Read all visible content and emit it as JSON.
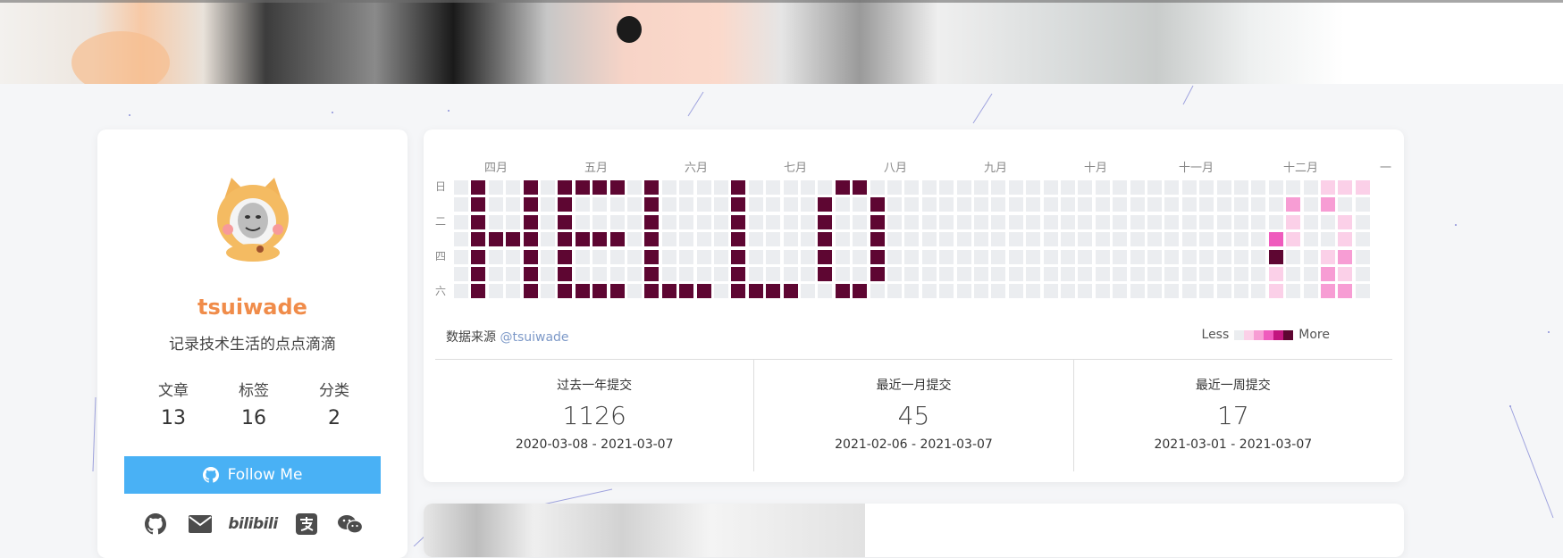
{
  "profile": {
    "name": "tsuiwade",
    "description": "记录技术生活的点点滴滴",
    "stats": [
      {
        "label": "文章",
        "value": "13"
      },
      {
        "label": "标签",
        "value": "16"
      },
      {
        "label": "分类",
        "value": "2"
      }
    ],
    "follow_label": "Follow Me",
    "socials": [
      "github-icon",
      "email-icon",
      "bilibili-icon",
      "alipay-icon",
      "wechat-icon"
    ],
    "bilibili_text": "bilibili",
    "accent_color": "#49b1f5",
    "name_color": "#f08c4a"
  },
  "calendar": {
    "months": [
      "四月",
      "五月",
      "六月",
      "七月",
      "八月",
      "九月",
      "十月",
      "十一月",
      "十二月",
      "一"
    ],
    "weekdays": [
      "日",
      "二",
      "四",
      "六"
    ],
    "source_label": "数据来源",
    "source_link": "@tsuiwade",
    "legend_less": "Less",
    "legend_more": "More",
    "colors": {
      "empty": "#ebedf0",
      "levels": [
        "#fbd0e8",
        "#f79dd4",
        "#ef5bbd",
        "#c2167f",
        "#5e0632"
      ]
    },
    "summary": [
      {
        "title": "过去一年提交",
        "value": "1126",
        "range": "2020-03-08 - 2021-03-07"
      },
      {
        "title": "最近一月提交",
        "value": "45",
        "range": "2021-02-06 - 2021-03-07"
      },
      {
        "title": "最近一周提交",
        "value": "17",
        "range": "2021-03-01 - 2021-03-07"
      }
    ],
    "pattern": {
      "weeks": 53,
      "dark_cells": [
        [
          1,
          0
        ],
        [
          1,
          1
        ],
        [
          1,
          2
        ],
        [
          1,
          3
        ],
        [
          1,
          4
        ],
        [
          1,
          5
        ],
        [
          1,
          6
        ],
        [
          2,
          3
        ],
        [
          3,
          3
        ],
        [
          4,
          0
        ],
        [
          4,
          1
        ],
        [
          4,
          2
        ],
        [
          4,
          3
        ],
        [
          4,
          4
        ],
        [
          4,
          5
        ],
        [
          4,
          6
        ],
        [
          6,
          0
        ],
        [
          6,
          1
        ],
        [
          6,
          2
        ],
        [
          6,
          3
        ],
        [
          6,
          4
        ],
        [
          6,
          5
        ],
        [
          6,
          6
        ],
        [
          7,
          0
        ],
        [
          7,
          3
        ],
        [
          7,
          6
        ],
        [
          8,
          0
        ],
        [
          8,
          3
        ],
        [
          8,
          6
        ],
        [
          9,
          0
        ],
        [
          9,
          3
        ],
        [
          9,
          6
        ],
        [
          11,
          0
        ],
        [
          11,
          1
        ],
        [
          11,
          2
        ],
        [
          11,
          3
        ],
        [
          11,
          4
        ],
        [
          11,
          5
        ],
        [
          11,
          6
        ],
        [
          12,
          6
        ],
        [
          13,
          6
        ],
        [
          14,
          6
        ],
        [
          16,
          0
        ],
        [
          16,
          1
        ],
        [
          16,
          2
        ],
        [
          16,
          3
        ],
        [
          16,
          4
        ],
        [
          16,
          5
        ],
        [
          16,
          6
        ],
        [
          17,
          6
        ],
        [
          18,
          6
        ],
        [
          19,
          6
        ],
        [
          21,
          1
        ],
        [
          21,
          2
        ],
        [
          21,
          3
        ],
        [
          21,
          4
        ],
        [
          21,
          5
        ],
        [
          22,
          0
        ],
        [
          22,
          6
        ],
        [
          23,
          0
        ],
        [
          23,
          6
        ],
        [
          24,
          1
        ],
        [
          24,
          2
        ],
        [
          24,
          3
        ],
        [
          24,
          4
        ],
        [
          24,
          5
        ],
        [
          47,
          4
        ]
      ],
      "pink_cells": [
        [
          47,
          3,
          3
        ],
        [
          47,
          5,
          1
        ],
        [
          47,
          6,
          1
        ],
        [
          48,
          1,
          2
        ],
        [
          48,
          2,
          1
        ],
        [
          48,
          3,
          1
        ],
        [
          50,
          0,
          1
        ],
        [
          50,
          1,
          2
        ],
        [
          50,
          4,
          1
        ],
        [
          50,
          5,
          2
        ],
        [
          50,
          6,
          2
        ],
        [
          51,
          0,
          1
        ],
        [
          51,
          2,
          1
        ],
        [
          51,
          3,
          1
        ],
        [
          51,
          4,
          2
        ],
        [
          51,
          5,
          1
        ],
        [
          51,
          6,
          2
        ],
        [
          52,
          0,
          1
        ]
      ]
    }
  }
}
